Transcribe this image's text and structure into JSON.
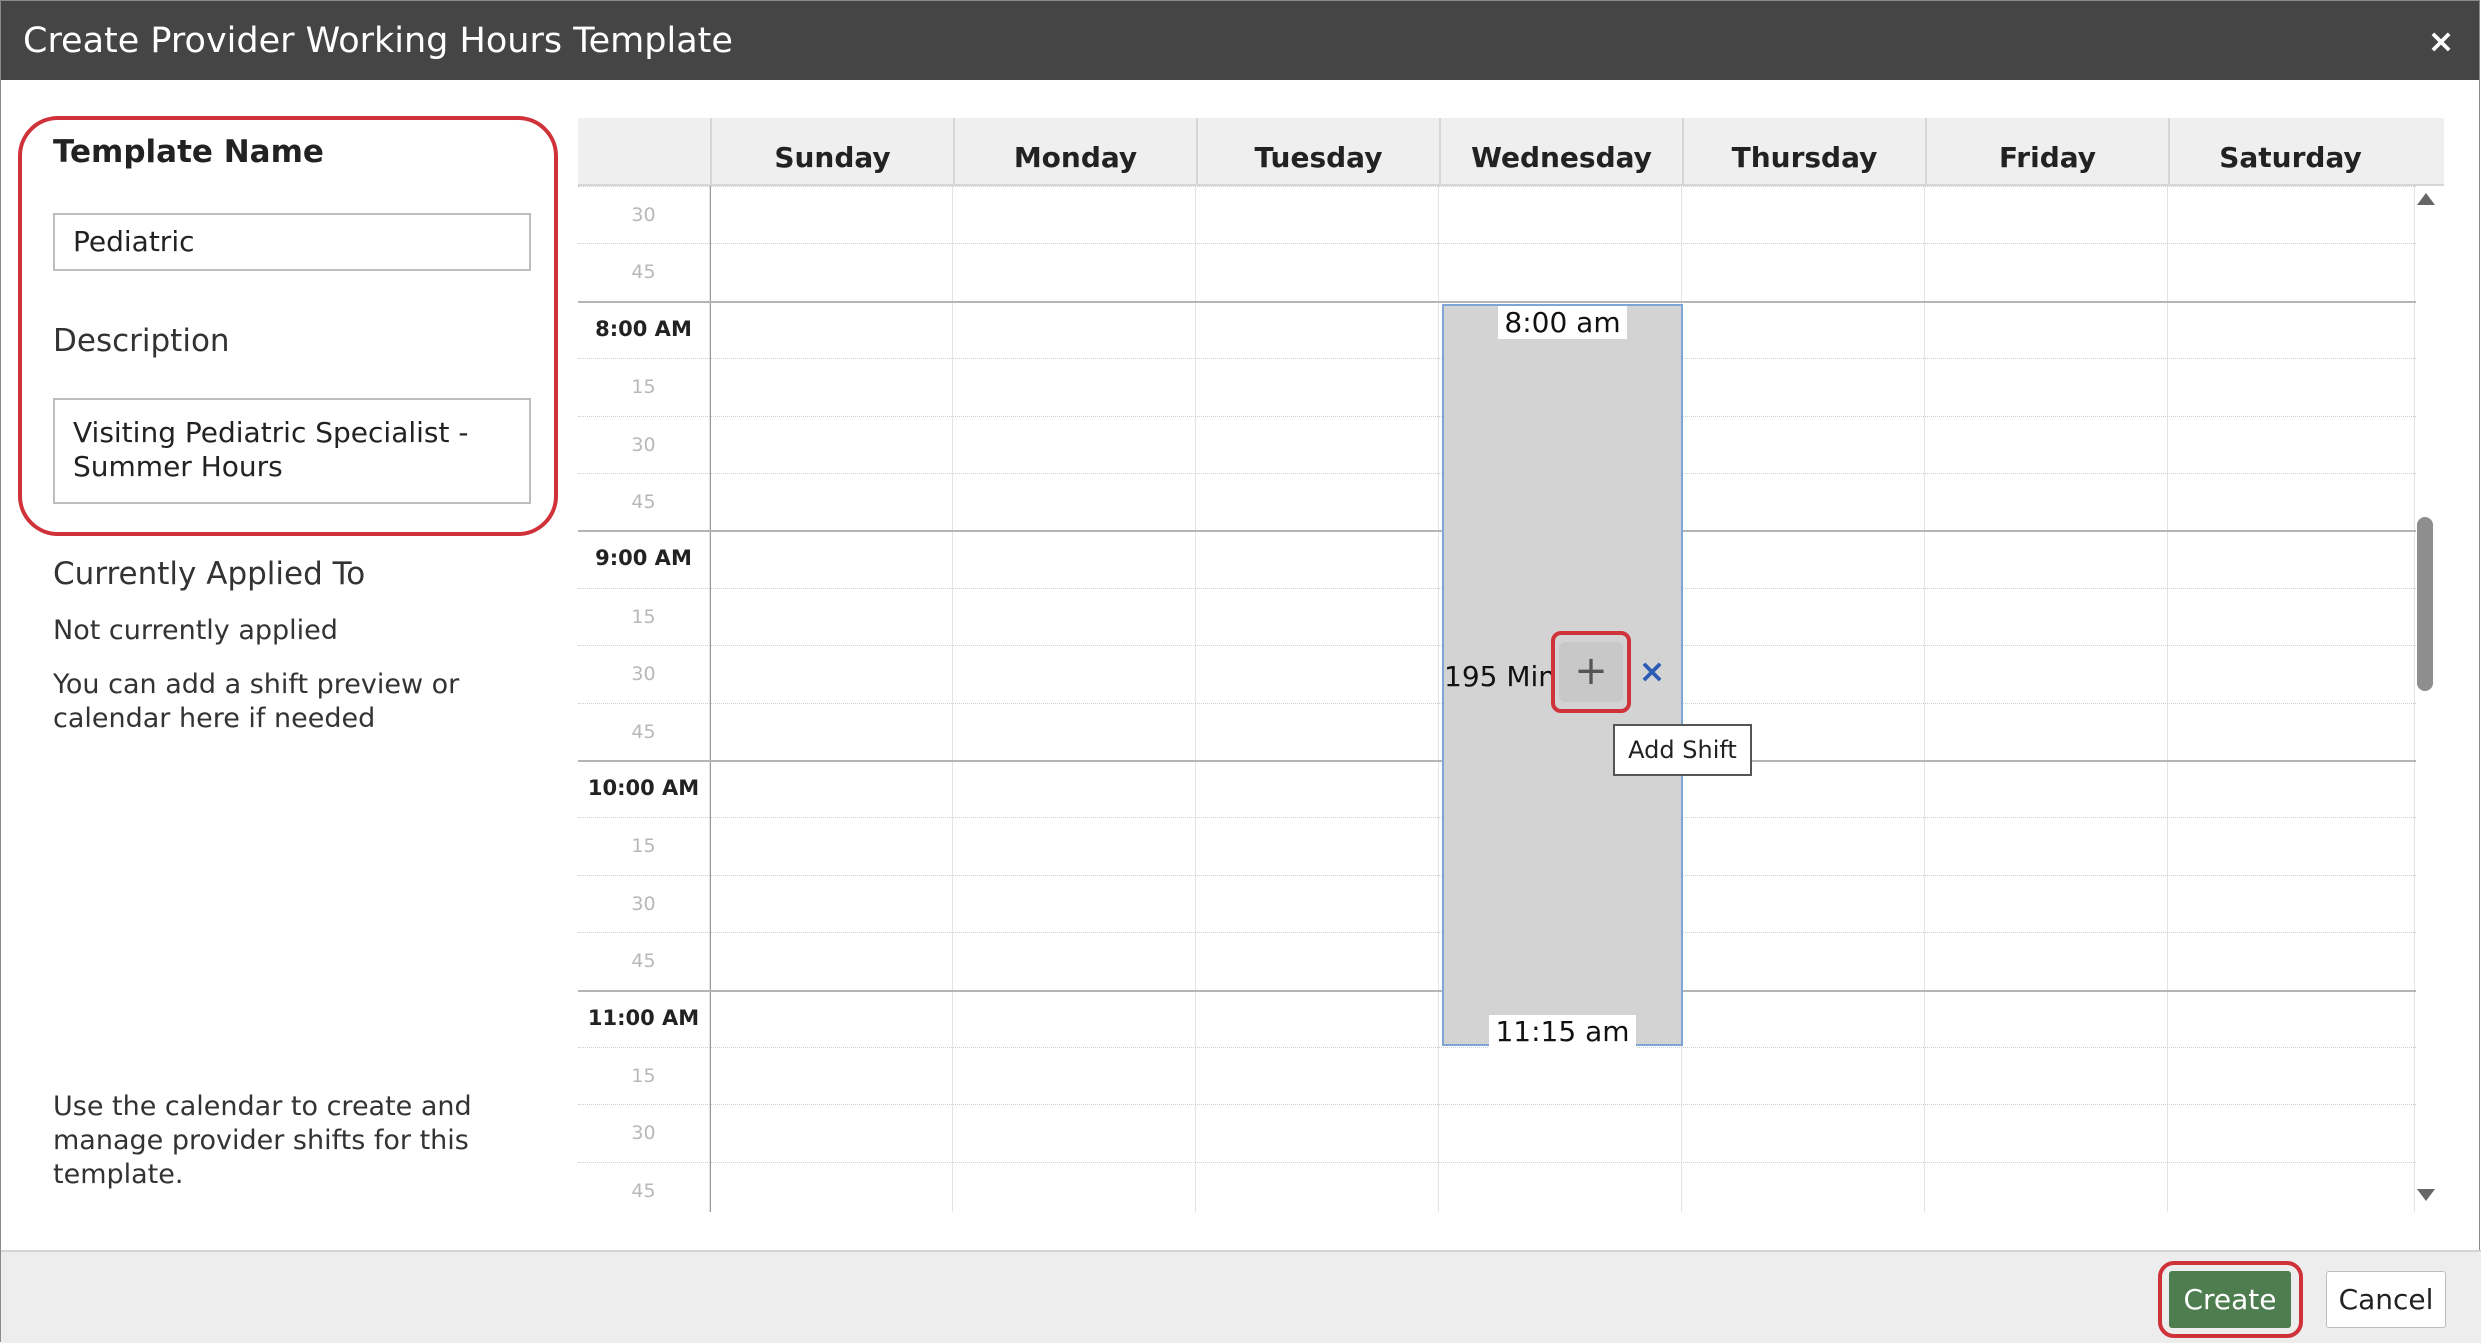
{
  "dialog": {
    "title": "Create Provider Working Hours Template",
    "close_glyph": "×"
  },
  "form": {
    "template_name_label": "Template Name",
    "template_name_value": "Pediatric",
    "description_label": "Description",
    "description_value": "Visiting Pediatric Specialist - Summer Hours",
    "applied_heading": "Currently Applied To",
    "applied_status": "Not currently applied",
    "hint_text": "You can add a shift preview or calendar here if needed",
    "footer_help": "Use the calendar to create and manage provider shifts for this template."
  },
  "calendar": {
    "days": [
      "Sunday",
      "Monday",
      "Tuesday",
      "Wednesday",
      "Thursday",
      "Friday",
      "Saturday"
    ],
    "time_slots": [
      {
        "label": "30",
        "hour": false
      },
      {
        "label": "45",
        "hour": false
      },
      {
        "label": "8:00 AM",
        "hour": true
      },
      {
        "label": "15",
        "hour": false
      },
      {
        "label": "30",
        "hour": false
      },
      {
        "label": "45",
        "hour": false
      },
      {
        "label": "9:00 AM",
        "hour": true
      },
      {
        "label": "15",
        "hour": false
      },
      {
        "label": "30",
        "hour": false
      },
      {
        "label": "45",
        "hour": false
      },
      {
        "label": "10:00 AM",
        "hour": true
      },
      {
        "label": "15",
        "hour": false
      },
      {
        "label": "30",
        "hour": false
      },
      {
        "label": "45",
        "hour": false
      },
      {
        "label": "11:00 AM",
        "hour": true
      },
      {
        "label": "15",
        "hour": false
      },
      {
        "label": "30",
        "hour": false
      },
      {
        "label": "45",
        "hour": false
      }
    ],
    "shift": {
      "day": "Wednesday",
      "start": "8:00 am",
      "end": "11:15 am",
      "duration": "195 Min",
      "add_glyph": "+",
      "remove_glyph": "×",
      "tooltip": "Add Shift"
    }
  },
  "footer": {
    "create_label": "Create",
    "cancel_label": "Cancel"
  },
  "colors": {
    "titlebar": "#454545",
    "highlight": "#d0323a",
    "create_button": "#4e7d50",
    "shift_fill": "#d3d3d3",
    "shift_border": "#7fa4d6",
    "remove_icon": "#2b5bb5"
  }
}
